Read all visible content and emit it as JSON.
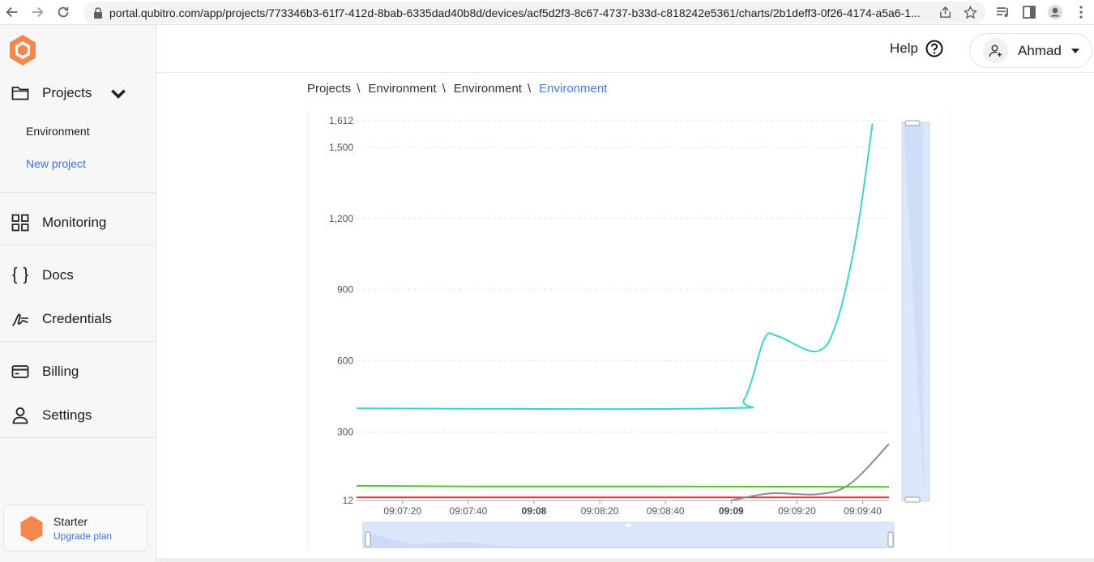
{
  "browser": {
    "url": "portal.qubitro.com/app/projects/773346b3-61f7-412d-8bab-6335dad40b8d/devices/acf5d2f3-8c67-4737-b33d-c818242e5361/charts/2b1deff3-0f26-4174-a5a6-1..."
  },
  "sidebar": {
    "projects_label": "Projects",
    "sub_items": [
      "Environment",
      "New project"
    ],
    "monitoring_label": "Monitoring",
    "docs_label": "Docs",
    "credentials_label": "Credentials",
    "billing_label": "Billing",
    "settings_label": "Settings",
    "plan": {
      "name": "Starter",
      "upgrade": "Upgrade plan"
    }
  },
  "header": {
    "help_label": "Help",
    "user_name": "Ahmad"
  },
  "breadcrumb": [
    "Projects",
    "Environment",
    "Environment",
    "Environment"
  ],
  "colors": {
    "accent": "#4a7cd6",
    "brand": "#f4874b",
    "series_teal": "#3fd3c8",
    "series_green": "#52c62a",
    "series_red": "#d1383a",
    "series_gray": "#8c8c8c"
  },
  "chart_data": {
    "type": "line",
    "y_ticks": [
      "1,612",
      "1,500",
      "1,200",
      "900",
      "600",
      "300",
      "12"
    ],
    "y_values": [
      1612,
      1500,
      1200,
      900,
      600,
      300,
      12
    ],
    "ylim": [
      12,
      1612
    ],
    "x_ticks": [
      "09:07:20",
      "09:07:40",
      "09:08",
      "09:08:20",
      "09:08:40",
      "09:09",
      "09:09:20",
      "09:09:40"
    ],
    "x_tick_bold": [
      false,
      false,
      true,
      false,
      false,
      true,
      false,
      false
    ],
    "x_tick_seconds": [
      20,
      40,
      60,
      80,
      100,
      120,
      140,
      160
    ],
    "xlim_seconds": [
      6,
      168
    ],
    "series": [
      {
        "color": "#3fd3c8",
        "points": [
          [
            6,
            400
          ],
          [
            116,
            400
          ],
          [
            124,
            440
          ],
          [
            130,
            690
          ],
          [
            134,
            705
          ],
          [
            146,
            640
          ],
          [
            152,
            760
          ],
          [
            158,
            1120
          ],
          [
            163,
            1600
          ]
        ]
      },
      {
        "color": "#52c62a",
        "points": [
          [
            6,
            74
          ],
          [
            40,
            71
          ],
          [
            100,
            71
          ],
          [
            140,
            70
          ],
          [
            168,
            69
          ]
        ]
      },
      {
        "color": "#d1383a",
        "points": [
          [
            6,
            25
          ],
          [
            168,
            25
          ]
        ]
      },
      {
        "color": "#8c8c8c",
        "points": [
          [
            120,
            12
          ],
          [
            132,
            42
          ],
          [
            146,
            38
          ],
          [
            156,
            80
          ],
          [
            168,
            250
          ]
        ]
      }
    ]
  }
}
